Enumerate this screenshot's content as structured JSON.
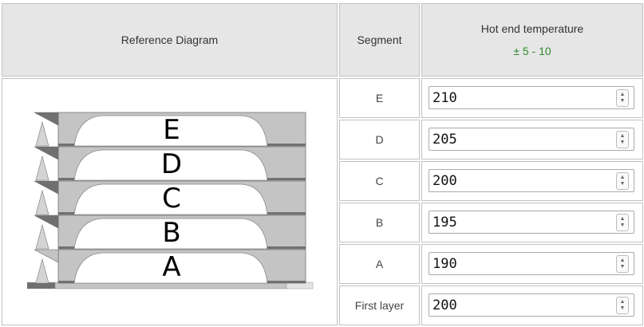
{
  "header": {
    "diagram_title": "Reference Diagram",
    "segment_title": "Segment",
    "temp_title": "Hot end temperature",
    "temp_tolerance": "± 5 - 10"
  },
  "diagram": {
    "letters": [
      "E",
      "D",
      "C",
      "B",
      "A"
    ]
  },
  "rows": [
    {
      "segment": "E",
      "value": "210"
    },
    {
      "segment": "D",
      "value": "205"
    },
    {
      "segment": "C",
      "value": "200"
    },
    {
      "segment": "B",
      "value": "195"
    },
    {
      "segment": "A",
      "value": "190"
    },
    {
      "segment": "First layer",
      "value": "200"
    }
  ],
  "colors": {
    "header_bg": "#e6e6e6",
    "border": "#c2c2c2",
    "tolerance_green": "#2e8b2e",
    "block_fill": "#c4c4c4",
    "block_dark": "#707070"
  }
}
